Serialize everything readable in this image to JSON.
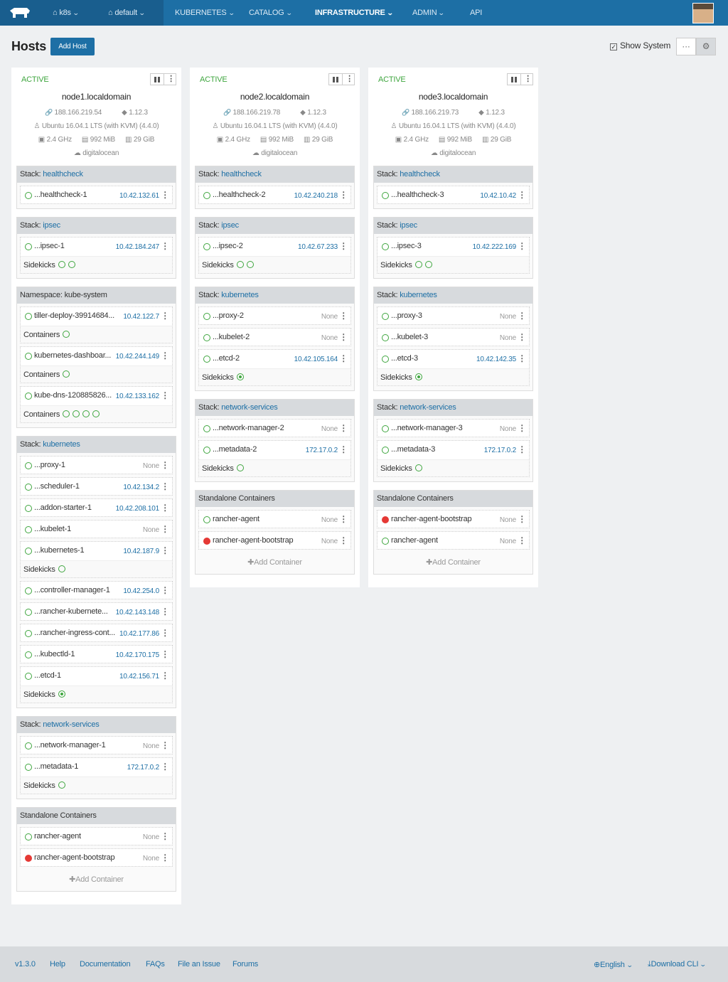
{
  "nav": {
    "env": "k8s",
    "project": "default",
    "items": [
      "KUBERNETES",
      "CATALOG",
      "INFRASTRUCTURE",
      "ADMIN",
      "API"
    ]
  },
  "header": {
    "title": "Hosts",
    "add_label": "Add Host",
    "show_system": "Show System",
    "toggle_list": "···",
    "toggle_grid": "⚙"
  },
  "hosts": [
    {
      "state": "ACTIVE",
      "name": "node1.localdomain",
      "ip": "188.166.219.54",
      "docker": "1.12.3",
      "os": "Ubuntu 16.04.1 LTS (with KVM) (4.4.0)",
      "cpu": "2.4 GHz",
      "mem": "992 MiB",
      "disk": "29 GiB",
      "provider": "digitalocean",
      "groups": [
        {
          "label": "Stack:",
          "link": "healthcheck",
          "rows": [
            {
              "name": "...healthcheck-1",
              "ip": "10.42.132.61"
            }
          ]
        },
        {
          "label": "Stack:",
          "link": "ipsec",
          "rows": [
            {
              "name": "...ipsec-1",
              "ip": "10.42.184.247",
              "sidekicks": "Sidekicks",
              "sk": [
                "o",
                "o"
              ]
            }
          ]
        },
        {
          "label": "Namespace: kube-system",
          "link": "",
          "rows": [
            {
              "name": "tiller-deploy-39914684...",
              "ip": "10.42.122.7",
              "sidekicks": "Containers",
              "sk": [
                "o"
              ]
            },
            {
              "name": "kubernetes-dashboar...",
              "ip": "10.42.244.149",
              "sidekicks": "Containers",
              "sk": [
                "o"
              ]
            },
            {
              "name": "kube-dns-120885826...",
              "ip": "10.42.133.162",
              "sidekicks": "Containers",
              "sk": [
                "o",
                "o",
                "o",
                "o"
              ]
            }
          ]
        },
        {
          "label": "Stack:",
          "link": "kubernetes",
          "rows": [
            {
              "name": "...proxy-1",
              "ip": "None"
            },
            {
              "name": "...scheduler-1",
              "ip": "10.42.134.2"
            },
            {
              "name": "...addon-starter-1",
              "ip": "10.42.208.101"
            },
            {
              "name": "...kubelet-1",
              "ip": "None"
            },
            {
              "name": "...kubernetes-1",
              "ip": "10.42.187.9",
              "sidekicks": "Sidekicks",
              "sk": [
                "o"
              ]
            },
            {
              "name": "...controller-manager-1",
              "ip": "10.42.254.0"
            },
            {
              "name": "...rancher-kubernete...",
              "ip": "10.42.143.148"
            },
            {
              "name": "...rancher-ingress-cont...",
              "ip": "10.42.177.86"
            },
            {
              "name": "...kubectld-1",
              "ip": "10.42.170.175"
            },
            {
              "name": "...etcd-1",
              "ip": "10.42.156.71",
              "sidekicks": "Sidekicks",
              "sk": [
                "f"
              ]
            }
          ]
        },
        {
          "label": "Stack:",
          "link": "network-services",
          "rows": [
            {
              "name": "...network-manager-1",
              "ip": "None"
            },
            {
              "name": "...metadata-1",
              "ip": "172.17.0.2",
              "sidekicks": "Sidekicks",
              "sk": [
                "o"
              ]
            }
          ]
        },
        {
          "label": "Standalone Containers",
          "link": "",
          "standalone": true,
          "rows": [
            {
              "name": "rancher-agent",
              "ip": "None"
            },
            {
              "name": "rancher-agent-bootstrap",
              "ip": "None",
              "red": true
            }
          ]
        }
      ]
    },
    {
      "state": "ACTIVE",
      "name": "node2.localdomain",
      "ip": "188.166.219.78",
      "docker": "1.12.3",
      "os": "Ubuntu 16.04.1 LTS (with KVM) (4.4.0)",
      "cpu": "2.4 GHz",
      "mem": "992 MiB",
      "disk": "29 GiB",
      "provider": "digitalocean",
      "groups": [
        {
          "label": "Stack:",
          "link": "healthcheck",
          "rows": [
            {
              "name": "...healthcheck-2",
              "ip": "10.42.240.218"
            }
          ]
        },
        {
          "label": "Stack:",
          "link": "ipsec",
          "rows": [
            {
              "name": "...ipsec-2",
              "ip": "10.42.67.233",
              "sidekicks": "Sidekicks",
              "sk": [
                "o",
                "o"
              ]
            }
          ]
        },
        {
          "label": "Stack:",
          "link": "kubernetes",
          "rows": [
            {
              "name": "...proxy-2",
              "ip": "None"
            },
            {
              "name": "...kubelet-2",
              "ip": "None"
            },
            {
              "name": "...etcd-2",
              "ip": "10.42.105.164",
              "sidekicks": "Sidekicks",
              "sk": [
                "f"
              ]
            }
          ]
        },
        {
          "label": "Stack:",
          "link": "network-services",
          "rows": [
            {
              "name": "...network-manager-2",
              "ip": "None"
            },
            {
              "name": "...metadata-2",
              "ip": "172.17.0.2",
              "sidekicks": "Sidekicks",
              "sk": [
                "o"
              ]
            }
          ]
        },
        {
          "label": "Standalone Containers",
          "link": "",
          "standalone": true,
          "rows": [
            {
              "name": "rancher-agent",
              "ip": "None"
            },
            {
              "name": "rancher-agent-bootstrap",
              "ip": "None",
              "red": true
            }
          ]
        }
      ]
    },
    {
      "state": "ACTIVE",
      "name": "node3.localdomain",
      "ip": "188.166.219.73",
      "docker": "1.12.3",
      "os": "Ubuntu 16.04.1 LTS (with KVM) (4.4.0)",
      "cpu": "2.4 GHz",
      "mem": "992 MiB",
      "disk": "29 GiB",
      "provider": "digitalocean",
      "groups": [
        {
          "label": "Stack:",
          "link": "healthcheck",
          "rows": [
            {
              "name": "...healthcheck-3",
              "ip": "10.42.10.42"
            }
          ]
        },
        {
          "label": "Stack:",
          "link": "ipsec",
          "rows": [
            {
              "name": "...ipsec-3",
              "ip": "10.42.222.169",
              "sidekicks": "Sidekicks",
              "sk": [
                "o",
                "o"
              ]
            }
          ]
        },
        {
          "label": "Stack:",
          "link": "kubernetes",
          "rows": [
            {
              "name": "...proxy-3",
              "ip": "None"
            },
            {
              "name": "...kubelet-3",
              "ip": "None"
            },
            {
              "name": "...etcd-3",
              "ip": "10.42.142.35",
              "sidekicks": "Sidekicks",
              "sk": [
                "f"
              ]
            }
          ]
        },
        {
          "label": "Stack:",
          "link": "network-services",
          "rows": [
            {
              "name": "...network-manager-3",
              "ip": "None"
            },
            {
              "name": "...metadata-3",
              "ip": "172.17.0.2",
              "sidekicks": "Sidekicks",
              "sk": [
                "o"
              ]
            }
          ]
        },
        {
          "label": "Standalone Containers",
          "link": "",
          "standalone": true,
          "rows": [
            {
              "name": "rancher-agent-bootstrap",
              "ip": "None",
              "red": true
            },
            {
              "name": "rancher-agent",
              "ip": "None"
            }
          ]
        }
      ]
    }
  ],
  "add_container": "Add Container",
  "footer": {
    "version": "v1.3.0",
    "links": [
      "Help",
      "Documentation",
      "FAQs",
      "File an Issue",
      "Forums"
    ],
    "language": "English",
    "download": "Download CLI"
  },
  "colors": {
    "primary": "#1d6fa5",
    "active": "#3fa63f",
    "error": "#e53935"
  }
}
